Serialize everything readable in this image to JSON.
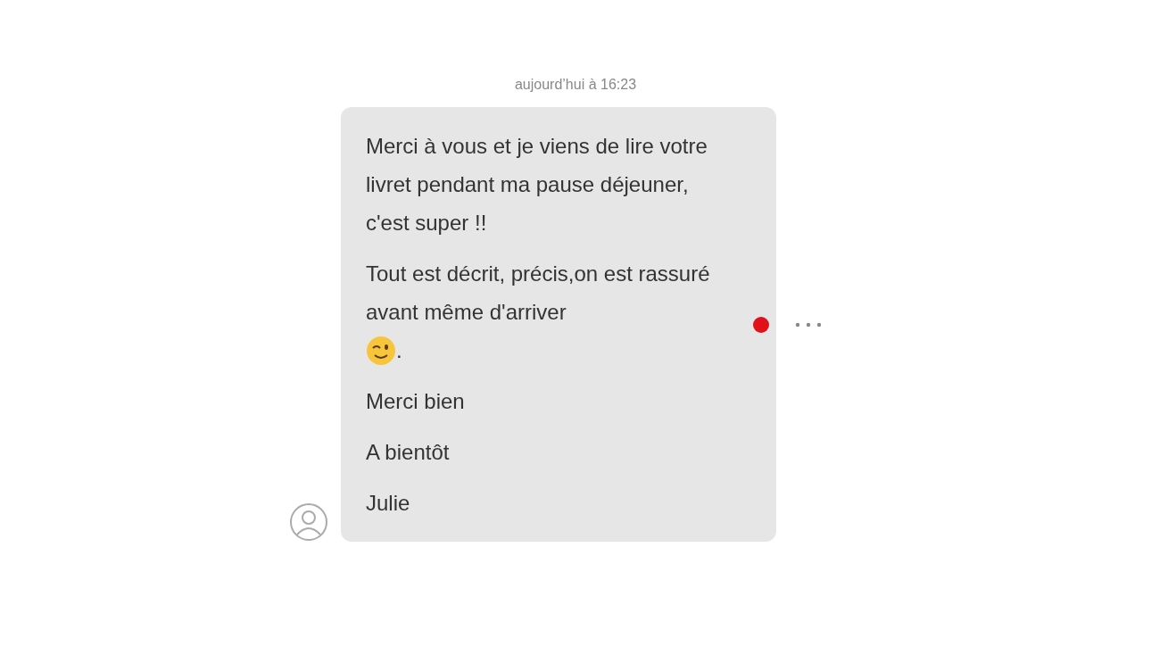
{
  "timestamp": "aujourd’hui à 16:23",
  "message": {
    "unread": true,
    "paragraphs": [
      {
        "kind": "text",
        "text": "Merci à vous et je viens de lire votre livret pendant ma pause déjeuner, c'est super !!"
      },
      {
        "kind": "emoji",
        "text": "Tout est décrit, précis,on est rassuré avant même d'arriver",
        "trailing": "."
      },
      {
        "kind": "text",
        "text": "Merci bien"
      },
      {
        "kind": "text",
        "text": "A bientôt"
      },
      {
        "kind": "text",
        "text": "Julie"
      }
    ]
  }
}
